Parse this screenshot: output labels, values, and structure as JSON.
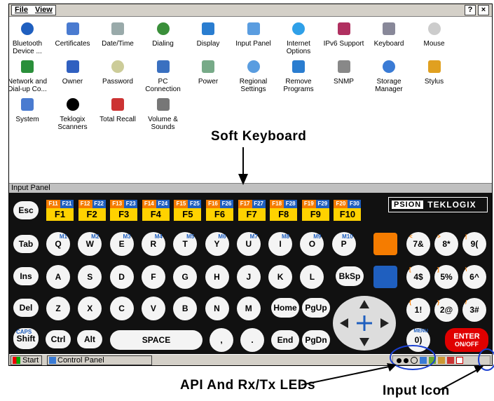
{
  "menubar": {
    "file": "File",
    "view": "View",
    "help": "?",
    "close": "×"
  },
  "control_panel": {
    "items": [
      {
        "label": "Bluetooth Device ...",
        "icon": "bluetooth-icon"
      },
      {
        "label": "Certificates",
        "icon": "certificates-icon"
      },
      {
        "label": "Date/Time",
        "icon": "clock-icon"
      },
      {
        "label": "Dialing",
        "icon": "phone-icon"
      },
      {
        "label": "Display",
        "icon": "display-icon"
      },
      {
        "label": "Input Panel",
        "icon": "input-panel-icon"
      },
      {
        "label": "Internet Options",
        "icon": "globe-icon"
      },
      {
        "label": "IPv6 Support",
        "icon": "ipv6-icon"
      },
      {
        "label": "Keyboard",
        "icon": "keyboard-icon"
      },
      {
        "label": "Mouse",
        "icon": "mouse-icon"
      },
      {
        "label": "Network and Dial-up Co...",
        "icon": "network-icon"
      },
      {
        "label": "Owner",
        "icon": "owner-icon"
      },
      {
        "label": "Password",
        "icon": "key-icon"
      },
      {
        "label": "PC Connection",
        "icon": "pc-connection-icon"
      },
      {
        "label": "Power",
        "icon": "power-icon"
      },
      {
        "label": "Regional Settings",
        "icon": "regional-icon"
      },
      {
        "label": "Remove Programs",
        "icon": "remove-programs-icon"
      },
      {
        "label": "SNMP",
        "icon": "snmp-icon"
      },
      {
        "label": "Storage Manager",
        "icon": "storage-icon"
      },
      {
        "label": "Stylus",
        "icon": "stylus-icon"
      },
      {
        "label": "System",
        "icon": "system-icon"
      },
      {
        "label": "Teklogix Scanners",
        "icon": "barcode-icon"
      },
      {
        "label": "Total Recall",
        "icon": "total-recall-icon"
      },
      {
        "label": "Volume & Sounds",
        "icon": "speaker-icon"
      }
    ]
  },
  "annotations": {
    "soft_keyboard": "Soft Keyboard",
    "api_leds": "API And Rx/Tx LEDs",
    "input_icon": "Input Icon"
  },
  "input_panel": {
    "title": "Input Panel",
    "fkeys": [
      {
        "o": "F11",
        "b": "F21",
        "main": "F1"
      },
      {
        "o": "F12",
        "b": "F22",
        "main": "F2"
      },
      {
        "o": "F13",
        "b": "F23",
        "main": "F3"
      },
      {
        "o": "F14",
        "b": "F24",
        "main": "F4"
      },
      {
        "o": "F15",
        "b": "F25",
        "main": "F5"
      },
      {
        "o": "F16",
        "b": "F26",
        "main": "F6"
      },
      {
        "o": "F17",
        "b": "F27",
        "main": "F7"
      },
      {
        "o": "F18",
        "b": "F28",
        "main": "F8"
      },
      {
        "o": "F19",
        "b": "F29",
        "main": "F9"
      },
      {
        "o": "F20",
        "b": "F30",
        "main": "F10"
      }
    ],
    "logo_psion": "PSION",
    "logo_teklogix": "TEKLOGIX",
    "row1": [
      "Esc"
    ],
    "row2": [
      "Tab",
      "Q",
      "W",
      "E",
      "R",
      "T",
      "Y",
      "U",
      "I",
      "O",
      "P"
    ],
    "row2_alt": [
      "M1",
      "M2",
      "M3",
      "M4",
      "M5",
      "M6",
      "M7",
      "M8",
      "M9",
      "M10"
    ],
    "row3": [
      "Ins",
      "A",
      "S",
      "D",
      "F",
      "G",
      "H",
      "J",
      "K",
      "L",
      "BkSp"
    ],
    "row4": [
      "Del",
      "Z",
      "X",
      "C",
      "V",
      "B",
      "N",
      "M",
      "Home",
      "PgUp"
    ],
    "row5": [
      "Shift",
      "Ctrl",
      "Alt",
      "SPACE",
      ",",
      ".",
      "End",
      "PgDn"
    ],
    "caps": "CAPS",
    "numpad": [
      [
        "7&",
        "8*",
        "9("
      ],
      [
        "4$",
        "5%",
        "6^"
      ],
      [
        "1!",
        "2@",
        "3#"
      ]
    ],
    "numpad_alt": [
      [
        "<",
        ">",
        "|"
      ],
      [
        "[",
        "]",
        "\\"
      ],
      [
        "{",
        "}",
        "/"
      ]
    ],
    "zero": "0)",
    "menu": "MENU",
    "enter": "ENTER",
    "on_off": "ON/OFF"
  },
  "taskbar": {
    "start": "Start",
    "task": "Control Panel"
  },
  "colors": {
    "orange": "#f57c00",
    "blue": "#1f5fbf",
    "yellow": "#ffd200",
    "enter_red": "#e00000"
  }
}
